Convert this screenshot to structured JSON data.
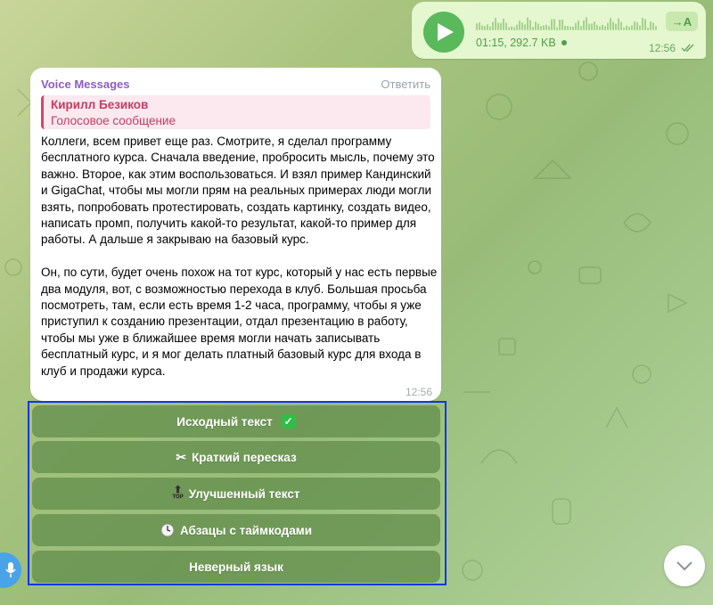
{
  "voice_message": {
    "duration_size": "01:15, 292.7 KB",
    "time": "12:56",
    "transcribe_label": "→A",
    "status": "read"
  },
  "bot_message": {
    "sender": "Voice Messages",
    "reply_label": "Ответить",
    "quote": {
      "author": "Кирилл Безиков",
      "text": "Голосовое сообщение"
    },
    "text": "Коллеги, всем привет еще раз. Смотрите, я сделал программу бесплатного курса. Сначала введение, пробросить мысль, почему это важно. Второе, как этим воспользоваться. И взял пример Кандинский и GigaChat, чтобы мы могли прям на реальных примерах люди могли взять, попробовать протестировать, создать картинку, создать видео, написать промп, получить какой-то результат, какой-то пример для работы. А дальше я закрываю на базовый курс.\n\nОн, по сути, будет очень похож на тот курс, который у нас есть первые два модуля, вот, с возможностью перехода в клуб. Большая просьба посмотреть, там, если есть время 1-2 часа, программу, чтобы я уже приступил к созданию презентации, отдал презентацию в работу, чтобы мы уже в ближайшее время могли начать записывать бесплатный курс, и я мог делать платный базовый курс для входа в клуб и продажи курса.",
    "time": "12:56"
  },
  "keyboard": [
    {
      "label": "Исходный текст",
      "icon": "check-mark-icon"
    },
    {
      "label": "Краткий пересказ",
      "icon": "scissors-icon"
    },
    {
      "label": "Улучшенный текст",
      "icon": "top-arrow-icon"
    },
    {
      "label": "Абзацы с таймкодами",
      "icon": "clock-icon"
    },
    {
      "label": "Неверный язык",
      "icon": ""
    }
  ],
  "colors": {
    "accent_green": "#59b95b",
    "sender_purple": "#8e5cc6",
    "quote_red": "#c83a62",
    "highlight_blue": "#1036e8"
  }
}
